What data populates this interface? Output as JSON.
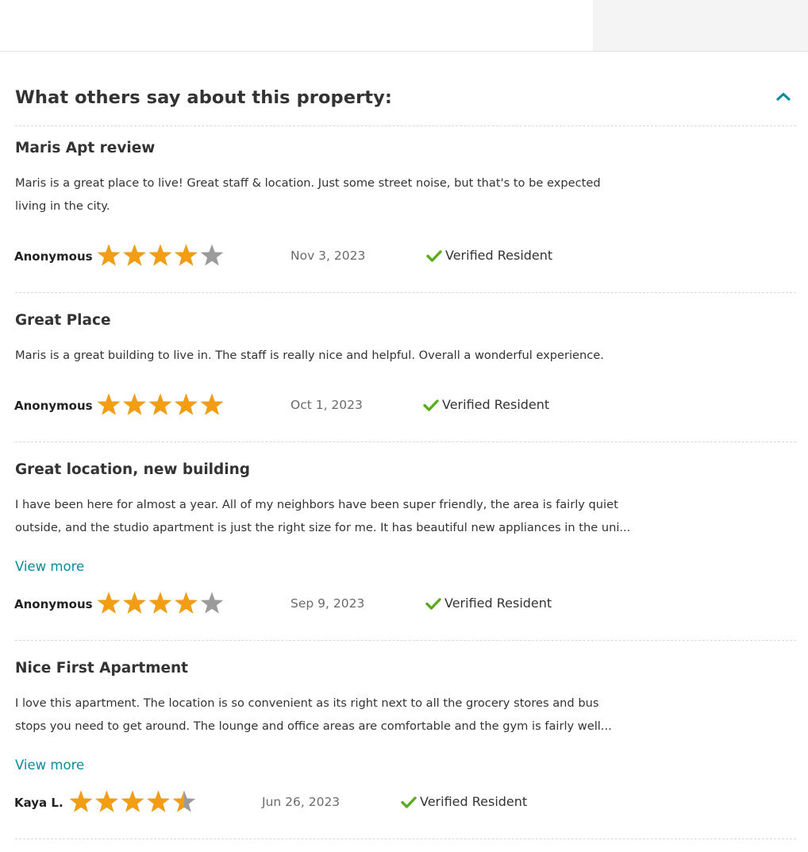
{
  "section": {
    "title": "What others say about this property:",
    "collapse_icon": "chevron-up-icon"
  },
  "colors": {
    "star_filled": "#f29d12",
    "star_empty": "#9b9b9b",
    "accent_link": "#0a8c9c",
    "verified_check": "#5aac1d"
  },
  "reviews": [
    {
      "title": "Maris Apt review",
      "body_lines": [
        "Maris is a great place to live!  Great staff & location. Just some street noise, but that's to be expected",
        "living in the city."
      ],
      "view_more": "",
      "author": "Anonymous",
      "rating": 4,
      "max_rating": 5,
      "date": "Nov 3, 2023",
      "verified": "Verified Resident"
    },
    {
      "title": "Great Place",
      "body_lines": [
        "Maris is a great building to live in. The staff is really nice and helpful. Overall a wonderful experience."
      ],
      "view_more": "",
      "author": "Anonymous",
      "rating": 5,
      "max_rating": 5,
      "date": "Oct 1, 2023",
      "verified": "Verified Resident"
    },
    {
      "title": "Great location, new building",
      "body_lines": [
        "I have been here for almost a year. All of my neighbors have been super friendly, the area is fairly quiet",
        "outside, and the studio apartment is just the right size for me. It has beautiful new appliances in the uni..."
      ],
      "view_more": "View more",
      "author": "Anonymous",
      "rating": 4,
      "max_rating": 5,
      "date": "Sep 9, 2023",
      "verified": "Verified Resident"
    },
    {
      "title": "Nice First Apartment",
      "body_lines": [
        "I love this apartment. The location is so convenient as its right next to all the grocery stores and bus",
        "stops you need to get around. The lounge and office areas are comfortable and the gym is fairly well..."
      ],
      "view_more": "View more",
      "author": "Kaya L.",
      "rating": 4.5,
      "max_rating": 5,
      "date": "Jun 26, 2023",
      "verified": "Verified Resident"
    }
  ]
}
